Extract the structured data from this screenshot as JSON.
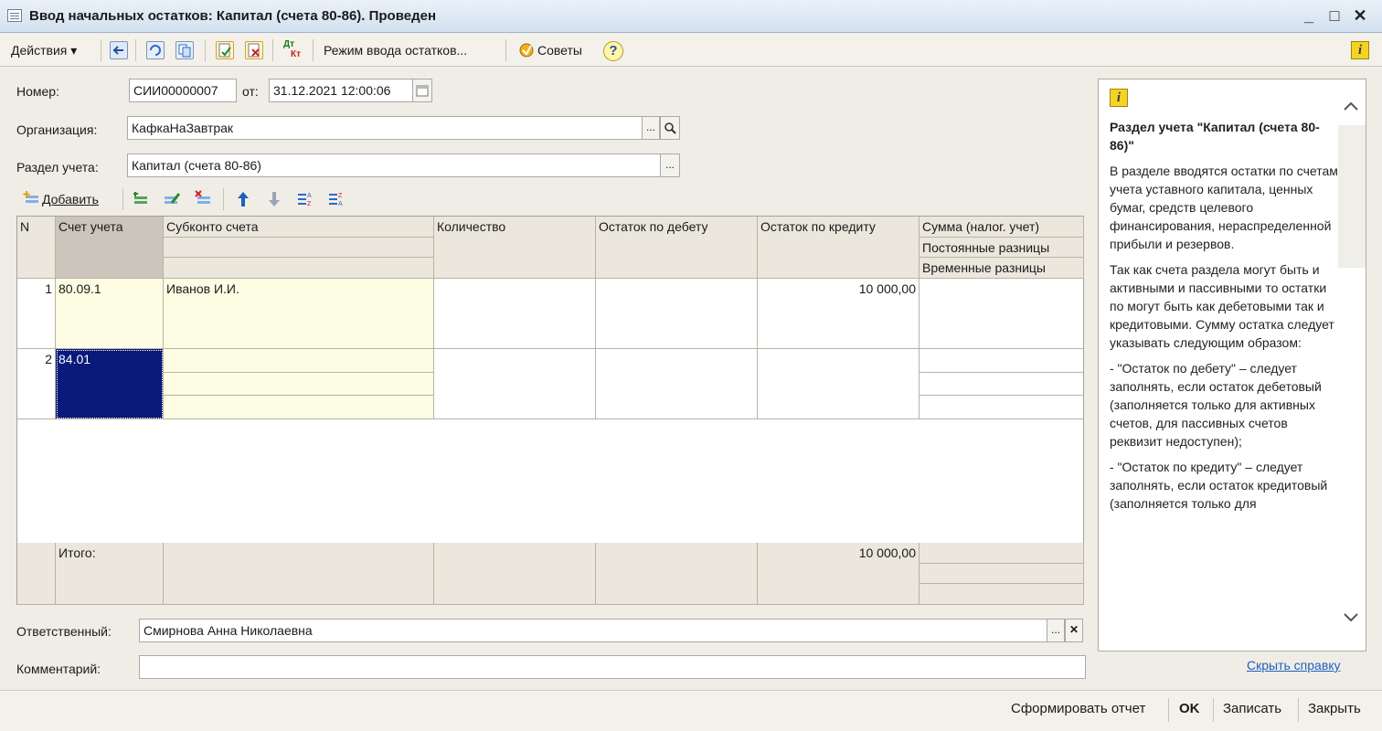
{
  "window": {
    "title": "Ввод начальных остатков: Капитал (счета 80-86). Проведен",
    "minimize": "_",
    "maximize": "□",
    "close": "✕"
  },
  "toolbar": {
    "actions": "Действия ▾",
    "mode": "Режим ввода остатков...",
    "tips": "Советы",
    "help": "?",
    "info": "i",
    "dtkt_top": "Дт",
    "dtkt_bottom": "Кт"
  },
  "form": {
    "number_label": "Номер:",
    "number": "СИИ00000007",
    "date_label": "от:",
    "date": "31.12.2021 12:00:06",
    "org_label": "Организация:",
    "org": "КафкаНаЗавтрак",
    "section_label": "Раздел учета:",
    "section": "Капитал (счета 80-86)",
    "responsible_label": "Ответственный:",
    "responsible": "Смирнова Анна Николаевна",
    "comment_label": "Комментарий:",
    "comment": "",
    "dots": "...",
    "x": "✕"
  },
  "table_toolbar": {
    "add": "Добавить"
  },
  "table": {
    "headers": {
      "n": "N",
      "account": "Счет учета",
      "subconto": "Субконто счета",
      "quantity": "Количество",
      "debit": "Остаток по дебету",
      "credit": "Остаток по кредиту",
      "sum_tax": "Сумма (налог. учет)",
      "const_diff": "Постоянные разницы",
      "temp_diff": "Временные разницы"
    },
    "rows": [
      {
        "n": "1",
        "account": "80.09.1",
        "subconto": "Иванов И.И.",
        "credit": "10 000,00"
      },
      {
        "n": "2",
        "account": "84.01",
        "subconto": "",
        "credit": ""
      }
    ],
    "total_label": "Итого:",
    "total_credit": "10 000,00"
  },
  "help_panel": {
    "info": "i",
    "title": "Раздел учета \"Капитал (счета 80-86)\"",
    "p1": "В разделе вводятся остатки по счетам учета уставного капитала, ценных бумаг, средств целевого финансирования, нераспределенной прибыли и резервов.",
    "p2": "Так как счета раздела могут быть и активными и пассивными то остатки по могут быть как дебетовыми так и кредитовыми. Сумму остатка следует указывать следующим образом:",
    "p3": "- \"Остаток по дебету\" – следует заполнять, если остаток дебетовый (заполняется только для активных счетов, для пассивных счетов реквизит недоступен);",
    "p4": "- \"Остаток по кредиту\" – следует заполнять, если остаток кредитовый (заполняется только для",
    "hide_link": "Скрыть справку"
  },
  "bottom": {
    "report": "Сформировать отчет",
    "ok": "OK",
    "save": "Записать",
    "close": "Закрыть"
  },
  "colors": {
    "row_highlight": "#fdfde3",
    "selected": "#0a1a7a",
    "header": "#ebe7dc",
    "link": "#1f5fbf"
  }
}
